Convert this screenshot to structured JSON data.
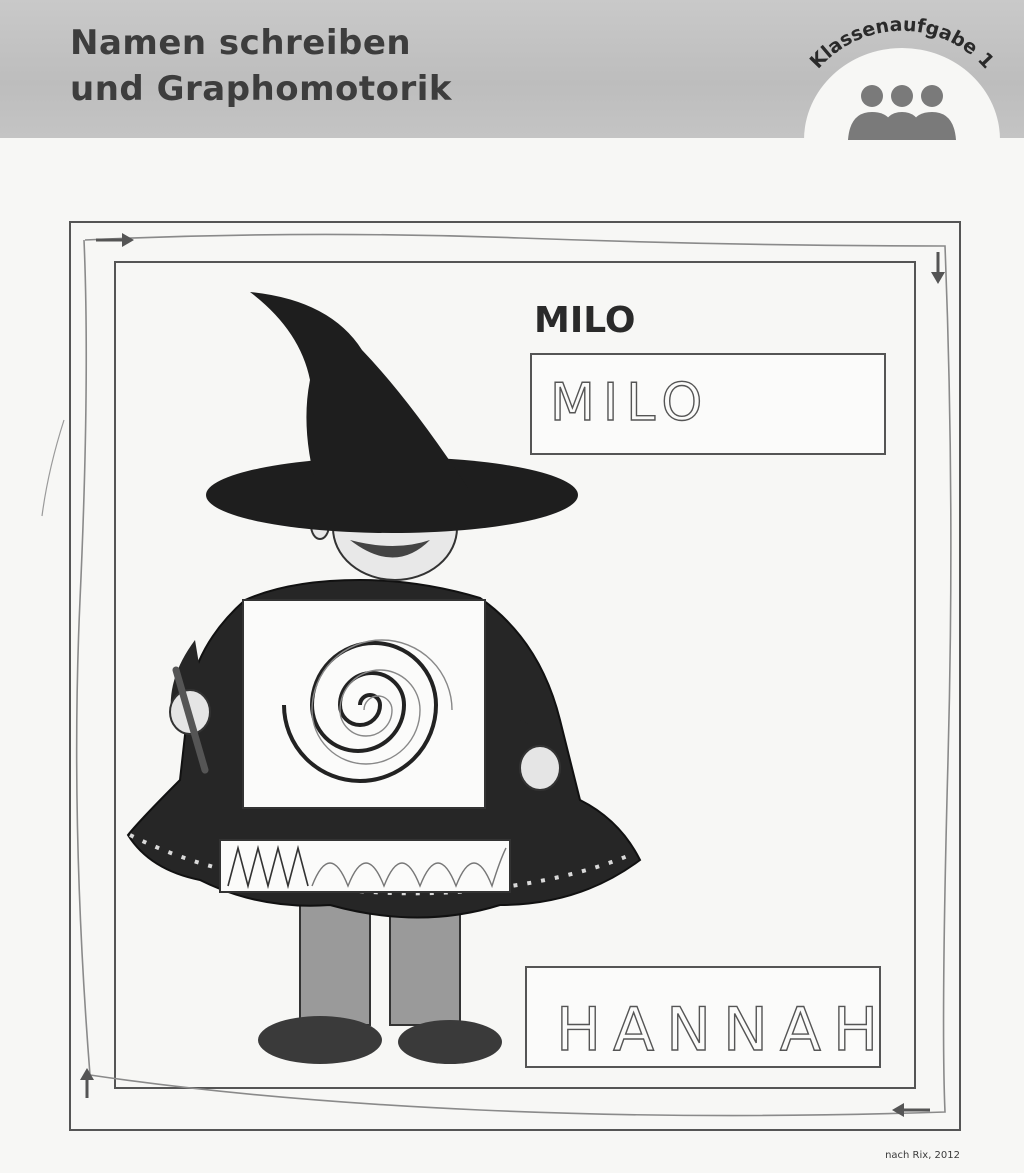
{
  "header": {
    "title_line1": "Namen schreiben",
    "title_line2": "und Graphomotorik",
    "badge_label": "Klassenaufgabe 1"
  },
  "worksheet": {
    "printed_name": "MILO",
    "handwritten_name_top": "MILO",
    "handwritten_name_bottom": "HANNAH"
  },
  "footer": {
    "credit": "nach Rix, 2012"
  }
}
